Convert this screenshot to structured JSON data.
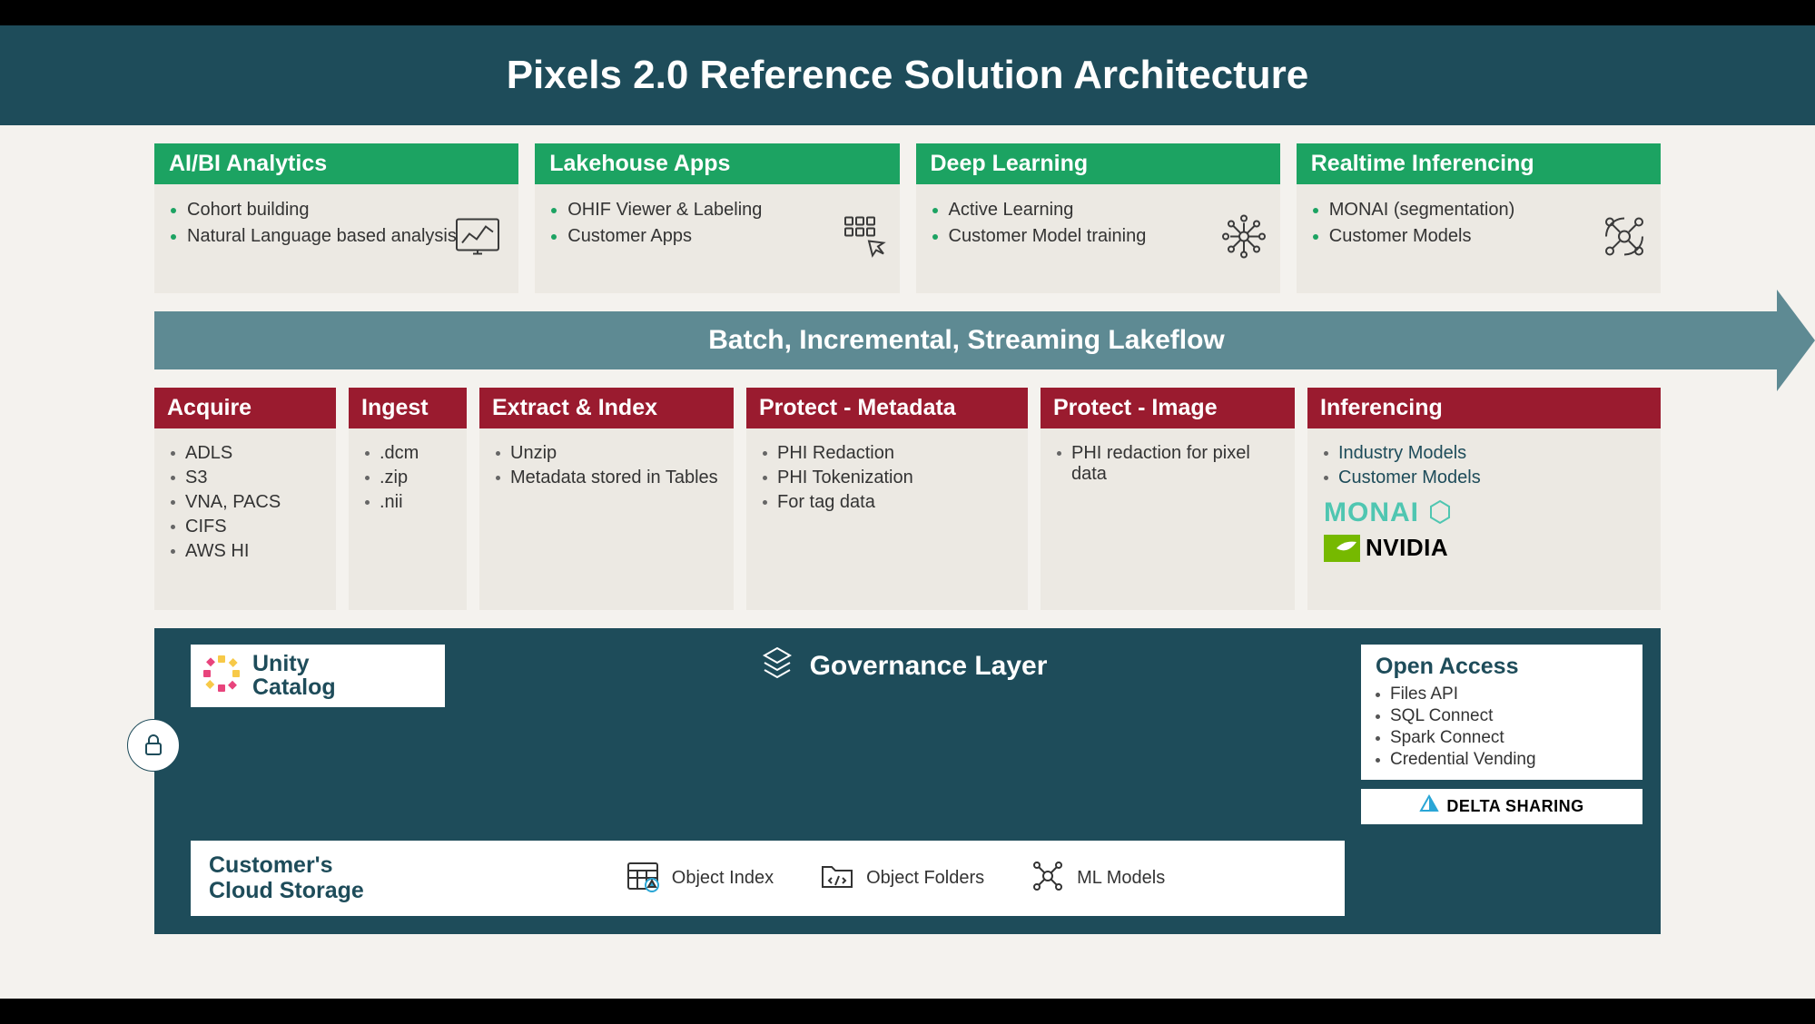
{
  "title": "Pixels 2.0 Reference Solution Architecture",
  "top_cards": [
    {
      "title": "AI/BI Analytics",
      "items": [
        "Cohort building",
        "Natural Language based analysis"
      ],
      "icon": "dashboard-chart-icon"
    },
    {
      "title": "Lakehouse Apps",
      "items": [
        "OHIF Viewer & Labeling",
        "Customer Apps"
      ],
      "icon": "grid-touch-icon"
    },
    {
      "title": "Deep Learning",
      "items": [
        "Active Learning",
        "Customer Model training"
      ],
      "icon": "neural-net-icon"
    },
    {
      "title": "Realtime Inferencing",
      "items": [
        "MONAI (segmentation)",
        "Customer Models"
      ],
      "icon": "inference-nodes-icon"
    }
  ],
  "flow_band": "Batch, Incremental, Streaming Lakeflow",
  "pipeline": {
    "acquire": {
      "title": "Acquire",
      "items": [
        "ADLS",
        "S3",
        "VNA, PACS",
        "CIFS",
        "AWS HI"
      ],
      "muted": [
        2
      ]
    },
    "ingest": {
      "title": "Ingest",
      "items": [
        ".dcm",
        ".zip",
        ".nii"
      ]
    },
    "extract": {
      "title": "Extract & Index",
      "items": [
        "Unzip",
        "Metadata stored in Tables"
      ]
    },
    "protect_meta": {
      "title": "Protect - Metadata",
      "items": [
        "PHI Redaction",
        "PHI Tokenization",
        "For tag data"
      ]
    },
    "protect_image": {
      "title": "Protect - Image",
      "items": [
        "PHI redaction for pixel data"
      ]
    },
    "inference": {
      "title": "Inferencing",
      "items": [
        "Industry Models",
        "Customer Models"
      ],
      "logos": {
        "monai": "MONAI",
        "nvidia": "NVIDIA"
      }
    }
  },
  "governance": {
    "unity": "Unity Catalog",
    "layer_title": "Governance Layer",
    "open_access": {
      "title": "Open Access",
      "items": [
        "Files API",
        "SQL Connect",
        "Spark Connect",
        "Credential Vending"
      ]
    },
    "delta": "DELTA SHARING",
    "storage": {
      "title": "Customer's Cloud Storage",
      "items": [
        {
          "label": "Object Index",
          "icon": "table-grid-icon"
        },
        {
          "label": "Object Folders",
          "icon": "code-folder-icon"
        },
        {
          "label": "ML Models",
          "icon": "ml-graph-icon"
        }
      ]
    }
  }
}
